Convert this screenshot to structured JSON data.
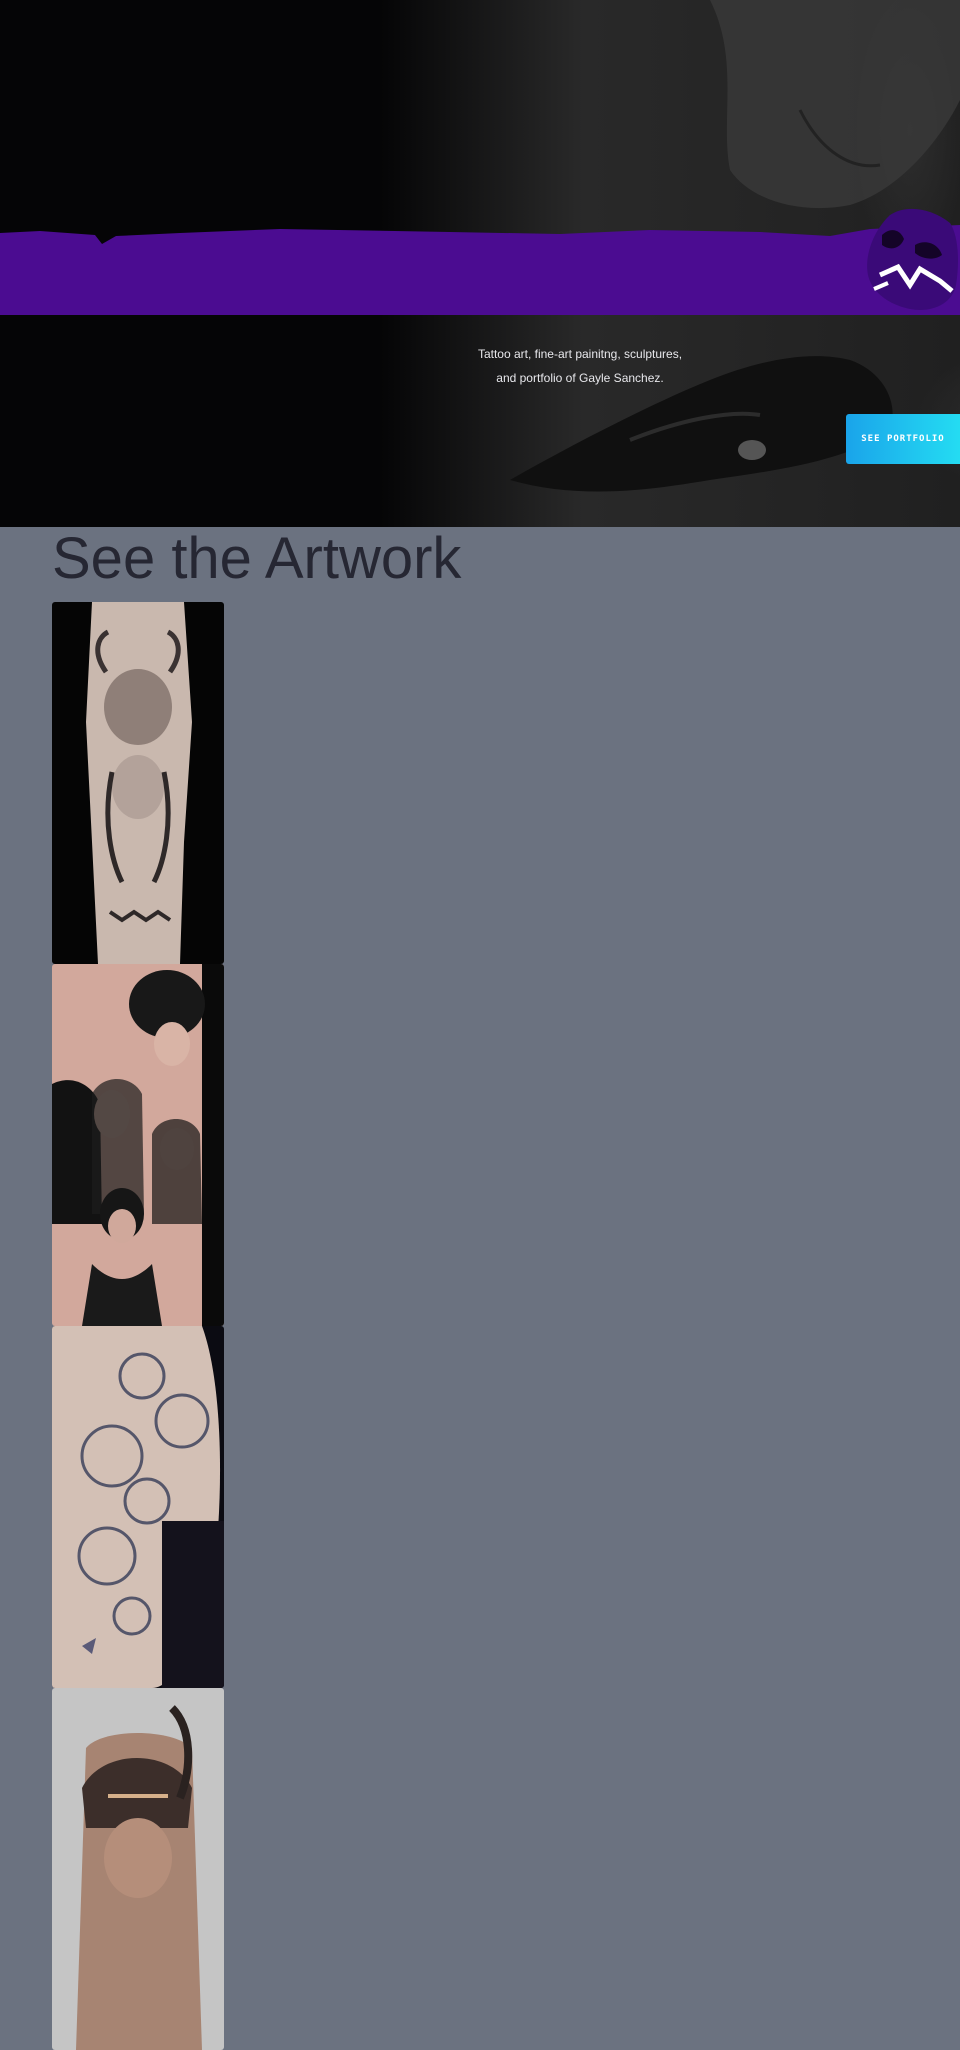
{
  "hero": {
    "tagline_line1": "Tattoo art, fine-art painitng, sculptures,",
    "tagline_line2": "and portfolio of Gayle Sanchez.",
    "cta_label": "SEE PORTFOLIO",
    "band_color": "#4b0c91",
    "logo_icon": "tiger-logo-icon"
  },
  "artwork": {
    "title": "See the Artwork",
    "items": [
      {
        "icon": "bull-woman-tattoo-image"
      },
      {
        "icon": "horror-women-tattoo-image"
      },
      {
        "icon": "floral-sleeve-tattoo-image"
      },
      {
        "icon": "woman-portrait-tattoo-image"
      }
    ]
  },
  "colors": {
    "page_background": "#6b7280",
    "title_text": "#262733",
    "cta_gradient_start": "#1aa4ea",
    "cta_gradient_end": "#24dcf2"
  }
}
